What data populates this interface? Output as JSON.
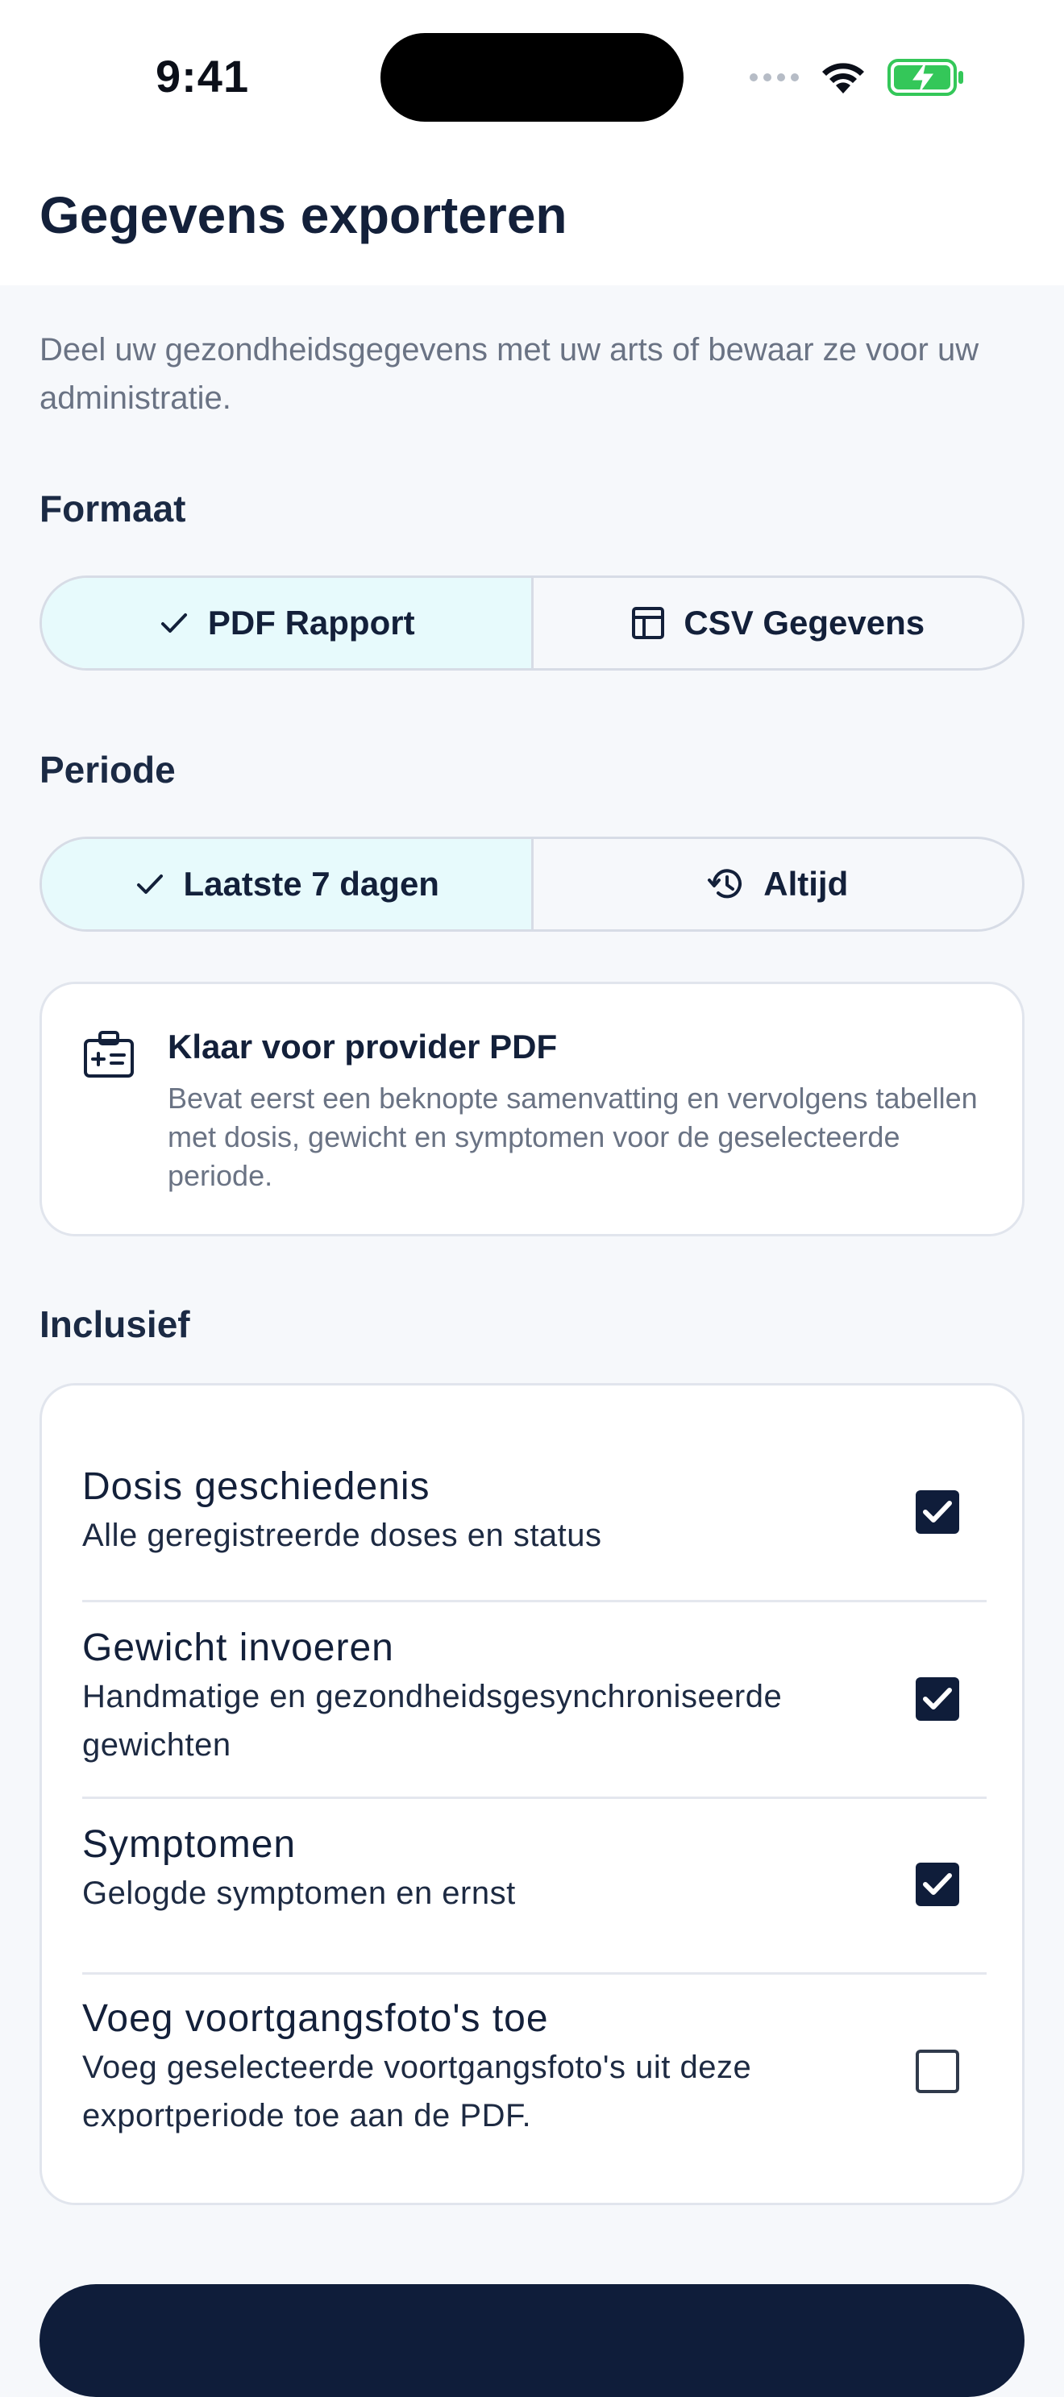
{
  "status_bar": {
    "time": "9:41"
  },
  "header": {
    "title": "Gegevens exporteren"
  },
  "intro": "Deel uw gezondheidsgegevens met uw arts of bewaar ze voor uw administratie.",
  "format": {
    "label": "Formaat",
    "options": [
      {
        "label": "PDF Rapport",
        "icon": "check-icon",
        "selected": true
      },
      {
        "label": "CSV Gegevens",
        "icon": "table-icon",
        "selected": false
      }
    ]
  },
  "period": {
    "label": "Periode",
    "options": [
      {
        "label": "Laatste 7 dagen",
        "icon": "check-icon",
        "selected": true
      },
      {
        "label": "Altijd",
        "icon": "history-icon",
        "selected": false
      }
    ]
  },
  "info_card": {
    "icon": "medical-id-icon",
    "title": "Klaar voor provider PDF",
    "description": "Bevat eerst een beknopte samenvatting en vervolgens tabellen met dosis, gewicht en symptomen voor de geselecteerde periode."
  },
  "include": {
    "label": "Inclusief",
    "items": [
      {
        "title": "Dosis geschiedenis",
        "description": "Alle geregistreerde doses en status",
        "checked": true
      },
      {
        "title": "Gewicht invoeren",
        "description": "Handmatige en gezondheidsgesynchroniseerde gewichten",
        "checked": true
      },
      {
        "title": "Symptomen",
        "description": "Gelogde symptomen en ernst",
        "checked": true
      },
      {
        "title": "Voeg voortgangsfoto's toe",
        "description": "Voeg geselecteerde voortgangsfoto's uit deze exportperiode toe aan de PDF.",
        "checked": false
      }
    ]
  },
  "colors": {
    "accent_selected": "#e7fafc",
    "primary": "#0f1d3a",
    "battery": "#34c759"
  }
}
